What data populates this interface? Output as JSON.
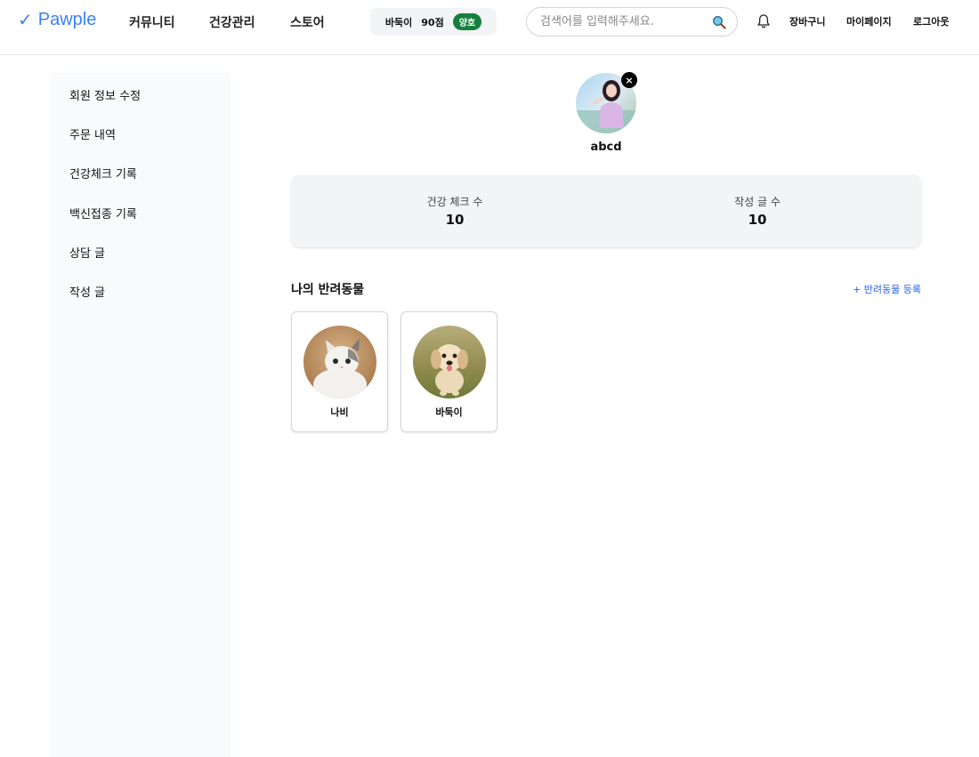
{
  "header": {
    "logo_check": "✓",
    "logo_text": "Pawple",
    "nav": [
      "커뮤니티",
      "건강관리",
      "스토어"
    ],
    "pet_chip": {
      "name": "바둑이",
      "score": "90점",
      "status": "양호"
    },
    "search": {
      "placeholder": "검색어를 입력해주세요."
    },
    "links": {
      "cart": "장바구니",
      "mypage": "마이페이지",
      "logout": "로그아웃"
    },
    "colors": {
      "brand": "#3b82f6",
      "status_good": "#15803d",
      "link": "#2563eb"
    },
    "icons": {
      "search": "search-icon",
      "bell": "bell-icon"
    }
  },
  "sidebar": {
    "items": [
      "회원 정보 수정",
      "주문 내역",
      "건강체크 기록",
      "백신접종 기록",
      "상담 글",
      "작성 글"
    ]
  },
  "profile": {
    "username": "abcd",
    "remove_icon": "×"
  },
  "stats": {
    "health_checks": {
      "label": "건강 체크 수",
      "value": "10"
    },
    "posts": {
      "label": "작성 글 수",
      "value": "10"
    }
  },
  "pets": {
    "title": "나의 반려동물",
    "add_label": "+ 반려동물 등록",
    "items": [
      {
        "name": "나비",
        "kind": "cat"
      },
      {
        "name": "바둑이",
        "kind": "dog"
      }
    ]
  }
}
